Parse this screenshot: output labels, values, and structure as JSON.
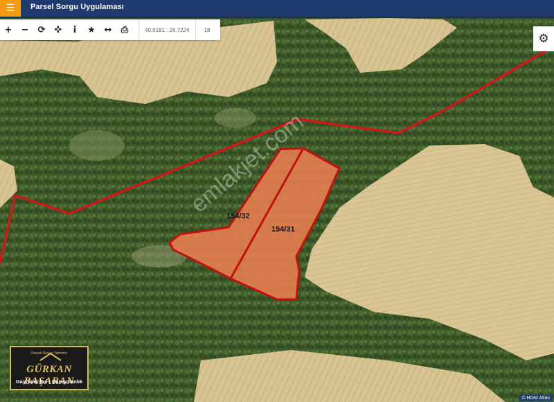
{
  "header": {
    "menu_icon": "hamburger-icon",
    "title": "Parsel Sorgu Uygulaması"
  },
  "toolbar": {
    "tools": [
      {
        "icon": "zoom-in-icon",
        "glyph": "+"
      },
      {
        "icon": "zoom-out-icon",
        "glyph": "−"
      },
      {
        "icon": "refresh-icon",
        "glyph": "⟳"
      },
      {
        "icon": "locate-icon",
        "glyph": "✜"
      },
      {
        "icon": "info-icon",
        "glyph": "i"
      },
      {
        "icon": "star-icon",
        "glyph": "★"
      },
      {
        "icon": "measure-icon",
        "glyph": "↔"
      },
      {
        "icon": "print-icon",
        "glyph": "⎙"
      }
    ],
    "coordinates": "40.9181 : 26.7224",
    "zoom_level": "18"
  },
  "settings": {
    "icon": "gear-icon",
    "glyph": "⚙"
  },
  "parcels": [
    {
      "label": "154/32"
    },
    {
      "label": "154/31"
    }
  ],
  "watermark": "emlakjet.com",
  "logo": {
    "tagline": "Gerçek Başarı Yatırımcı",
    "name": "GÜRKAN BAŞARAN",
    "subtitle": "Gayrimenkul - Danışmanlık"
  },
  "attribution": "© HGM Atlas",
  "colors": {
    "header_bg": "#1f3b70",
    "menu_accent": "#f39c12",
    "boundary_line": "#d01818",
    "parcel_fill": "#f08050",
    "field": "#d6c08e",
    "forest": "#3e5a2a"
  }
}
